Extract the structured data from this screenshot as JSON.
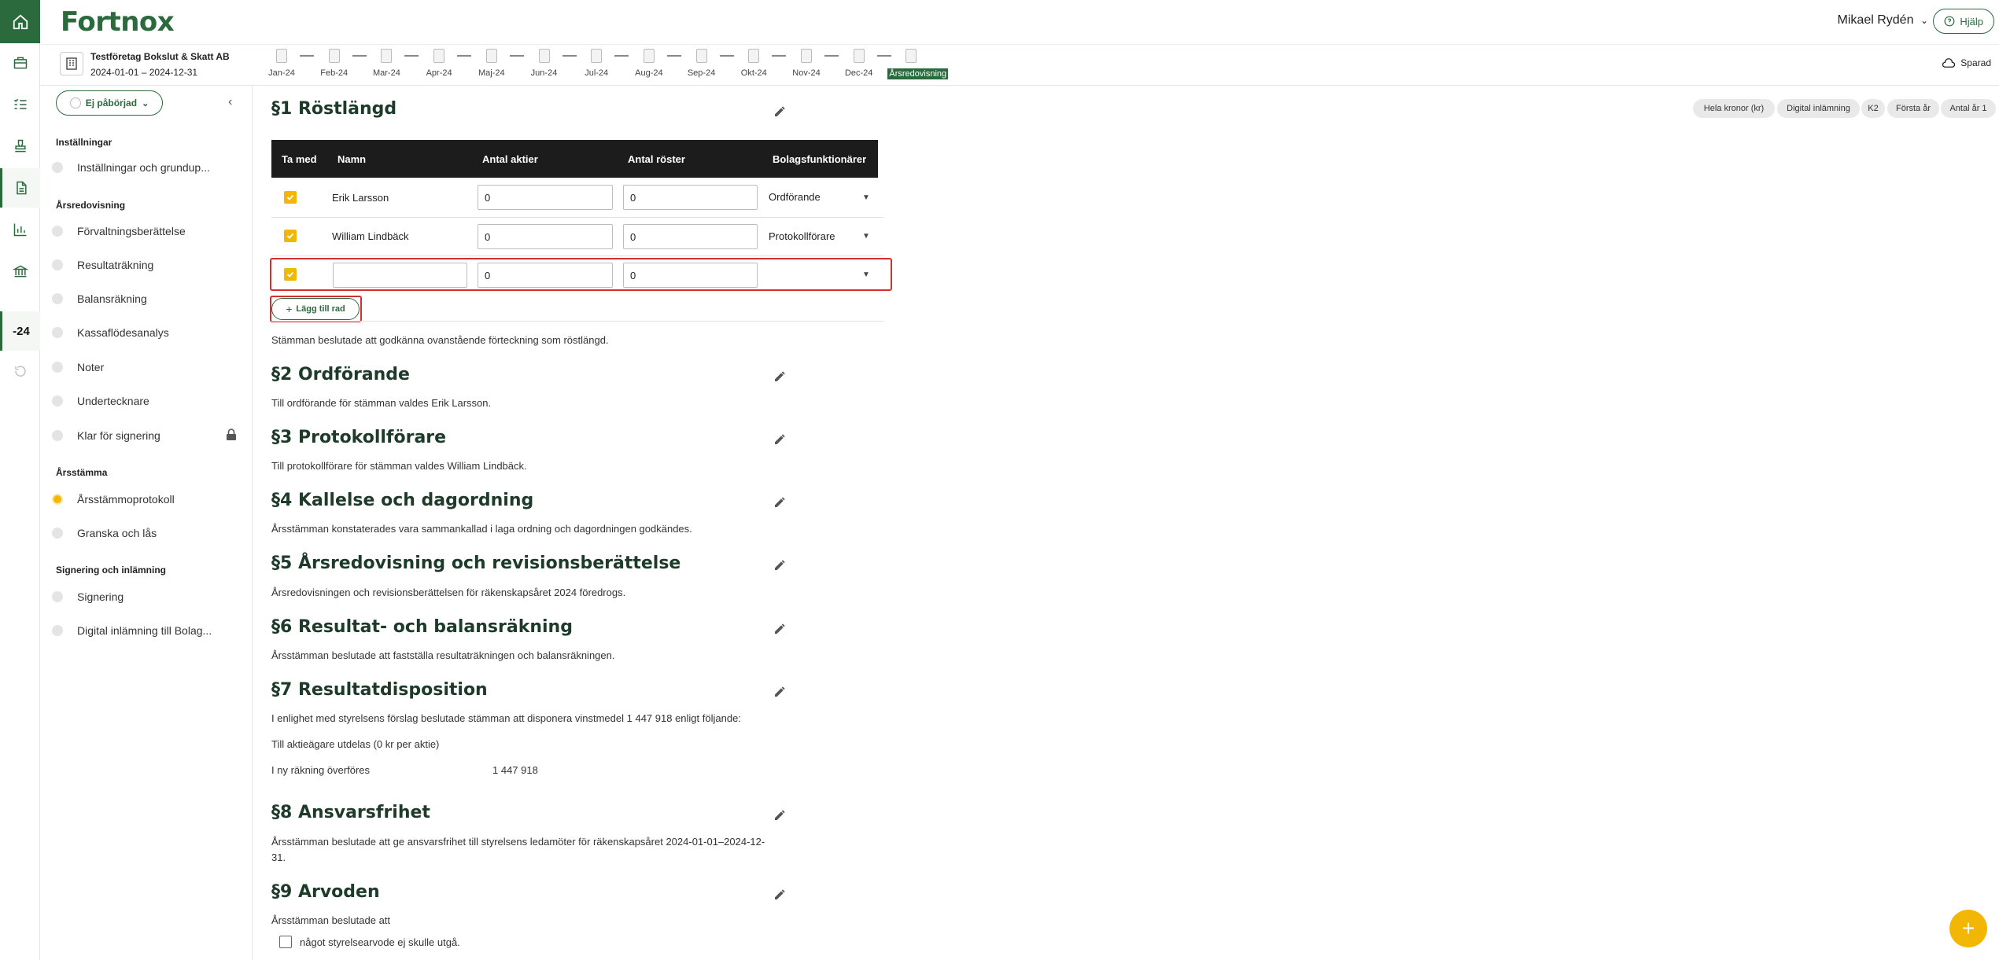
{
  "header": {
    "logo": "Fortnox",
    "user_name": "Mikael Rydén",
    "help_label": "Hjälp"
  },
  "rail": {
    "year_label": "-24"
  },
  "company": {
    "name": "Testföretag Bokslut & Skatt AB",
    "period": "2024-01-01 – 2024-12-31"
  },
  "months": [
    "Jan-24",
    "Feb-24",
    "Mar-24",
    "Apr-24",
    "Maj-24",
    "Jun-24",
    "Jul-24",
    "Aug-24",
    "Sep-24",
    "Okt-24",
    "Nov-24",
    "Dec-24",
    "Årsredovisning"
  ],
  "saved_label": "Sparad",
  "sidebar": {
    "status": "Ej påbörjad",
    "sections": [
      {
        "title": "Inställningar",
        "items": [
          "Inställningar och grundup..."
        ]
      },
      {
        "title": "Årsredovisning",
        "items": [
          "Förvaltningsberättelse",
          "Resultaträkning",
          "Balansräkning",
          "Kassaflödesanalys",
          "Noter",
          "Undertecknare",
          "Klar för signering"
        ]
      },
      {
        "title": "Årsstämma",
        "items": [
          "Årsstämmoprotokoll",
          "Granska och lås"
        ]
      },
      {
        "title": "Signering och inlämning",
        "items": [
          "Signering",
          "Digital inlämning till Bolag..."
        ]
      }
    ]
  },
  "tags": [
    "Hela kronor (kr)",
    "Digital inlämning",
    "K2",
    "Första år",
    "Antal år 1"
  ],
  "s1": {
    "title": "§1 Röstlängd",
    "columns": [
      "Ta med",
      "Namn",
      "Antal aktier",
      "Antal röster",
      "Bolagsfunktionärer"
    ],
    "rows": [
      {
        "name": "Erik Larsson",
        "shares": "0",
        "votes": "0",
        "role": "Ordförande"
      },
      {
        "name": "William Lindbäck",
        "shares": "0",
        "votes": "0",
        "role": "Protokollförare"
      },
      {
        "name": "",
        "shares": "0",
        "votes": "0",
        "role": ""
      }
    ],
    "add_row": "Lägg till rad",
    "text": "Stämman beslutade att godkänna ovanstående förteckning som röstlängd."
  },
  "s2": {
    "title": "§2 Ordförande",
    "text": "Till ordförande för stämman valdes Erik Larsson."
  },
  "s3": {
    "title": "§3 Protokollförare",
    "text": "Till protokollförare för stämman valdes William Lindbäck."
  },
  "s4": {
    "title": "§4 Kallelse och dagordning",
    "text": "Årsstämman konstaterades vara sammankallad i laga ordning och dagordningen godkändes."
  },
  "s5": {
    "title": "§5 Årsredovisning och revisionsberättelse",
    "text": "Årsredovisningen och revisionsberättelsen för räkenskapsåret 2024 föredrogs."
  },
  "s6": {
    "title": "§6 Resultat- och balansräkning",
    "text": "Årsstämman beslutade att fastställa resultaträkningen och balansräkningen."
  },
  "s7": {
    "title": "§7 Resultatdisposition",
    "text": "I enlighet med styrelsens förslag beslutade stämman att disponera vinstmedel 1 447 918 enligt följande:",
    "dividend": "Till aktieägare utdelas (0 kr per aktie)",
    "carry_label": "I ny räkning överföres",
    "carry_value": "1 447 918"
  },
  "s8": {
    "title": "§8 Ansvarsfrihet",
    "text_1": "Årsstämman beslutade att ge ansvarsfrihet till styrelsens ledamöter för räkenskapsåret 2024-01-01–2024-12-",
    "text_2": "31."
  },
  "s9": {
    "title": "§9 Arvoden",
    "text": "Årsstämman beslutade att",
    "option": "något styrelsearvode ej skulle utgå."
  }
}
